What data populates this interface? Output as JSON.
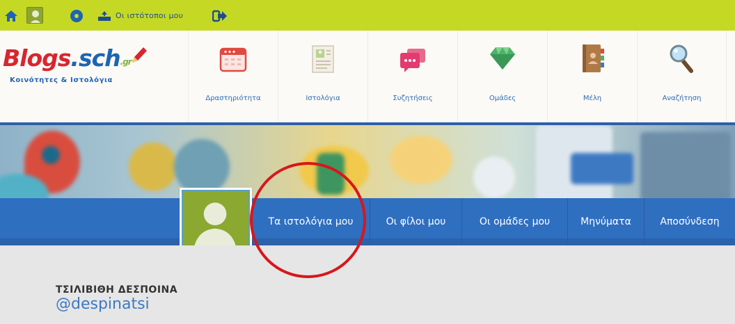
{
  "adminbar": {
    "sites_label": "Οι ιστότοποι μου",
    "bg_color": "#c5d924"
  },
  "header": {
    "logo": {
      "part_red": "Blogs",
      "part_blue": ".sch",
      "part_gr": ".gr",
      "subtitle": "Κοινότητες & Ιστολόγια"
    },
    "nav": [
      {
        "label": "Δραστηριότητα",
        "icon": "calendar-icon"
      },
      {
        "label": "Ιστολόγια",
        "icon": "document-icon"
      },
      {
        "label": "Συζητήσεις",
        "icon": "chat-icon"
      },
      {
        "label": "Ομάδες",
        "icon": "gem-icon"
      },
      {
        "label": "Μέλη",
        "icon": "address-book-icon"
      },
      {
        "label": "Αναζήτηση",
        "icon": "magnifier-icon"
      }
    ]
  },
  "profile_nav": {
    "tabs": [
      {
        "label": "Τα ιστολόγια μου"
      },
      {
        "label": "Οι φίλοι μου"
      },
      {
        "label": "Οι ομάδες μου"
      },
      {
        "label": "Μηνύματα"
      },
      {
        "label": "Αποσύνδεση"
      }
    ],
    "bg_color": "#2f6fc0"
  },
  "profile": {
    "name": "ΤΣΙΛΙΒΙΘΗ ΔΕΣΠΟΙΝΑ",
    "handle": "@despinatsi"
  },
  "annotation_color": "#d8161c"
}
